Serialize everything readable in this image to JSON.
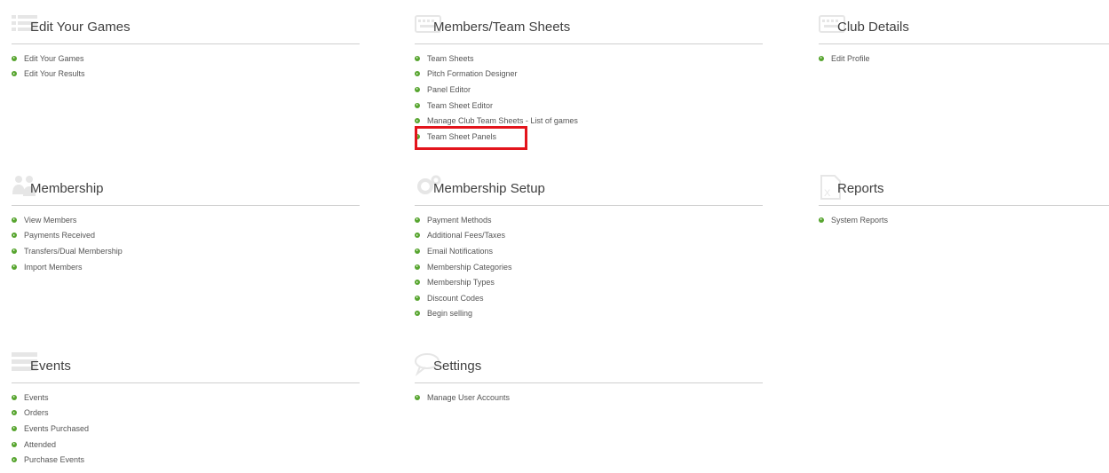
{
  "colors": {
    "bullet": "#57a52f",
    "highlight": "#e3141c",
    "divider": "#cfcfcf"
  },
  "panels": [
    {
      "title": "Edit Your Games",
      "icon": "list-icon",
      "items": [
        "Edit Your Games",
        "Edit Your Results"
      ]
    },
    {
      "title": "Members/Team Sheets",
      "icon": "keyboard-icon",
      "items": [
        "Team Sheets",
        "Pitch Formation Designer",
        "Panel Editor",
        "Team Sheet Editor",
        "Manage Club Team Sheets - List of games",
        "Team Sheet Panels"
      ]
    },
    {
      "title": "Club Details",
      "icon": "keyboard-icon",
      "items": [
        "Edit Profile"
      ]
    },
    {
      "title": "Membership",
      "icon": "users-icon",
      "items": [
        "View Members",
        "Payments Received",
        "Transfers/Dual Membership",
        "Import Members"
      ]
    },
    {
      "title": "Membership Setup",
      "icon": "gears-icon",
      "items": [
        "Payment Methods",
        "Additional Fees/Taxes",
        "Email Notifications",
        "Membership Categories",
        "Membership Types",
        "Discount Codes",
        "Begin selling"
      ]
    },
    {
      "title": "Reports",
      "icon": "excel-icon",
      "items": [
        "System Reports"
      ]
    },
    {
      "title": "Events",
      "icon": "list-icon",
      "items": [
        "Events",
        "Orders",
        "Events Purchased",
        "Attended",
        "Purchase Events"
      ]
    },
    {
      "title": "Settings",
      "icon": "speech-bubble-icon",
      "items": [
        "Manage User Accounts"
      ]
    }
  ]
}
